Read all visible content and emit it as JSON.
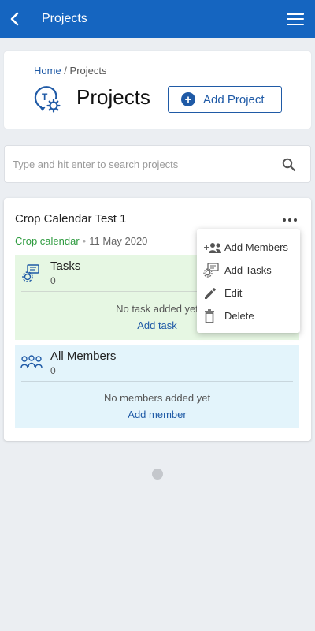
{
  "appbar": {
    "title": "Projects"
  },
  "breadcrumb": {
    "home": "Home",
    "separator": " / ",
    "current": "Projects"
  },
  "page": {
    "title": "Projects",
    "add_button": "Add Project"
  },
  "search": {
    "placeholder": "Type and hit enter to search projects",
    "value": ""
  },
  "project": {
    "name": "Crop Calendar Test 1",
    "tag": "Crop calendar",
    "separator": "•",
    "date": "11 May 2020",
    "tasks": {
      "title": "Tasks",
      "count": "0",
      "empty": "No task added yet",
      "add": "Add task"
    },
    "members": {
      "title": "All Members",
      "count": "0",
      "empty": "No members added yet",
      "add": "Add member"
    }
  },
  "menu": {
    "items": [
      {
        "label": "Add Members",
        "icon": "add-members-icon"
      },
      {
        "label": "Add Tasks",
        "icon": "add-tasks-icon"
      },
      {
        "label": "Edit",
        "icon": "pencil-icon"
      },
      {
        "label": "Delete",
        "icon": "trash-icon"
      }
    ]
  },
  "colors": {
    "primary": "#1565c0",
    "link": "#1f5aa6",
    "tag_green": "#2e9b3f",
    "tasks_bg": "#e6f7e3",
    "members_bg": "#e3f4fb",
    "page_bg": "#ebeef2"
  }
}
